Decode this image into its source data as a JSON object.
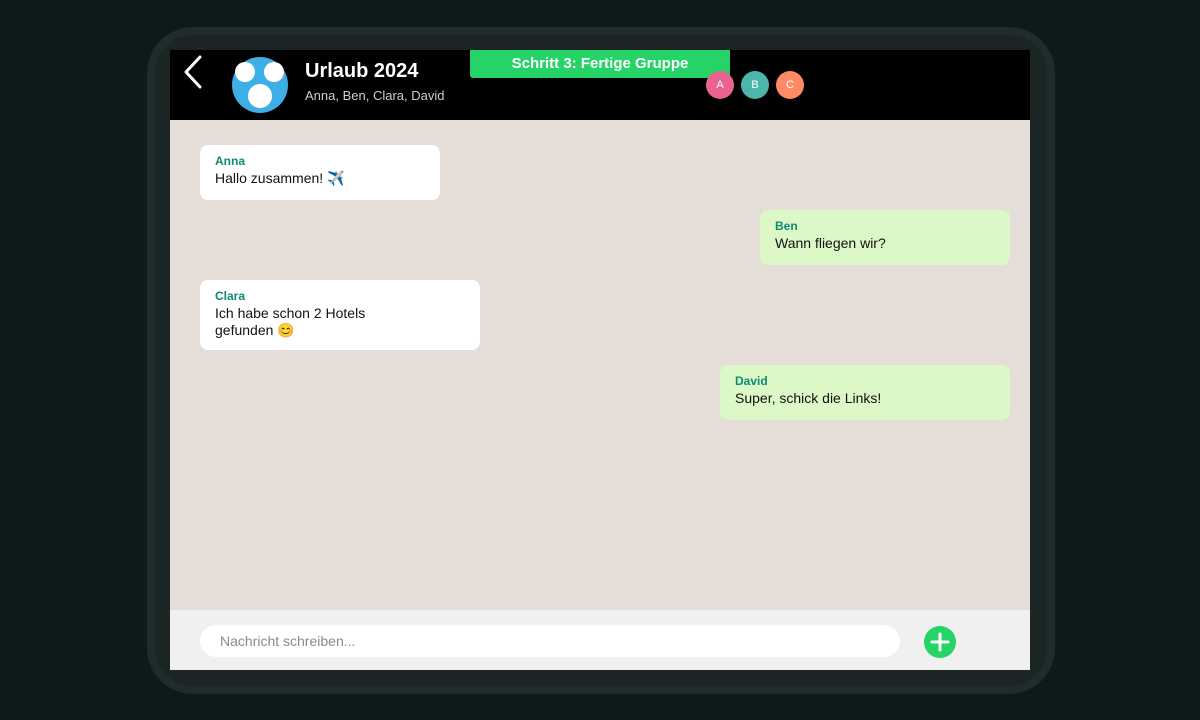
{
  "header": {
    "title": "Urlaub 2024",
    "members": "Anna, Ben, Clara, David",
    "step_banner": "Schritt 3: Fertige Gruppe",
    "member_chips": [
      {
        "initial": "A",
        "color": "#e8648f"
      },
      {
        "initial": "B",
        "color": "#4db6ac"
      },
      {
        "initial": "C",
        "color": "#ff8a65"
      }
    ]
  },
  "messages": [
    {
      "sender": "Anna",
      "text": "Hallo zusammen! ✈️",
      "direction": "incoming"
    },
    {
      "sender": "Ben",
      "text": "Wann fliegen wir?",
      "direction": "outgoing"
    },
    {
      "sender": "Clara",
      "text_line1": "Ich habe schon 2 Hotels",
      "text_line2": "gefunden 😊",
      "direction": "incoming"
    },
    {
      "sender": "David",
      "text": "Super, schick die Links!",
      "direction": "outgoing"
    }
  ],
  "composer": {
    "placeholder": "Nachricht schreiben...",
    "add_icon": "plus-icon"
  },
  "colors": {
    "accent": "#25d366",
    "outgoing_bubble": "#dcf8c6",
    "incoming_bubble": "#ffffff",
    "sender_name": "#0f8a75",
    "chat_background": "#e5ddd8",
    "header_background": "#000000"
  }
}
